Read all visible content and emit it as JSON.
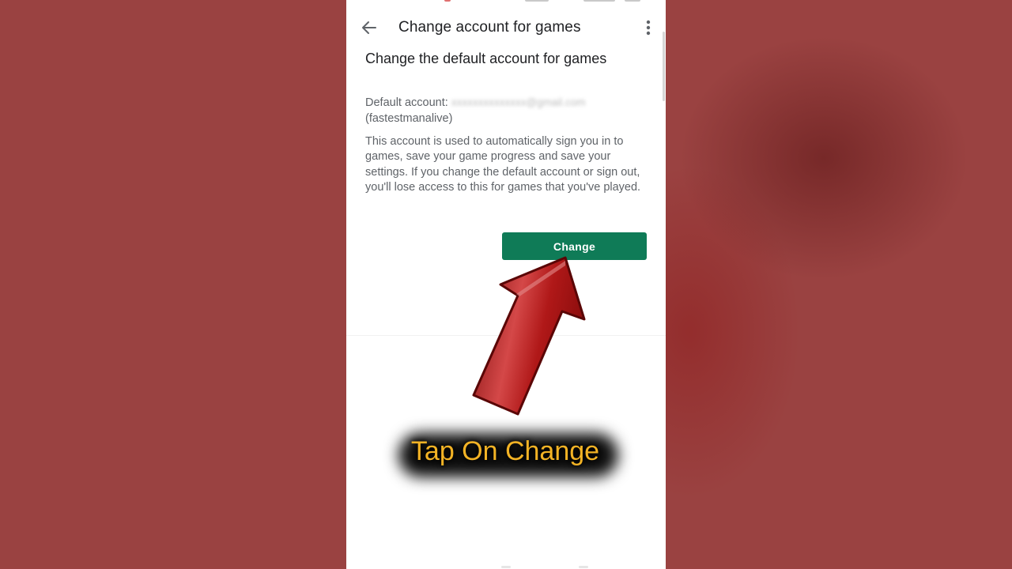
{
  "app_bar": {
    "title": "Change account for games",
    "back_icon": "arrow-left-icon",
    "more_icon": "more-vert-icon"
  },
  "content": {
    "heading": "Change the default account for games",
    "default_account_label": "Default account:",
    "default_account_email": "xxxxxxxxxxxxxx@gmail.com",
    "default_account_name": "(fastestmanalive)",
    "description": "This account is used to automatically sign you in to games, save your game progress and save your settings. If you change the default account or sign out, you'll lose access to this for games that you've played.",
    "change_button": "Change"
  },
  "overlay": {
    "caption": "Tap On Change",
    "arrow_icon": "pointing-arrow-icon"
  },
  "colors": {
    "background": "#9a4241",
    "button": "#0f7b57",
    "caption_text": "#f3b325",
    "arrow": "#b01818"
  }
}
